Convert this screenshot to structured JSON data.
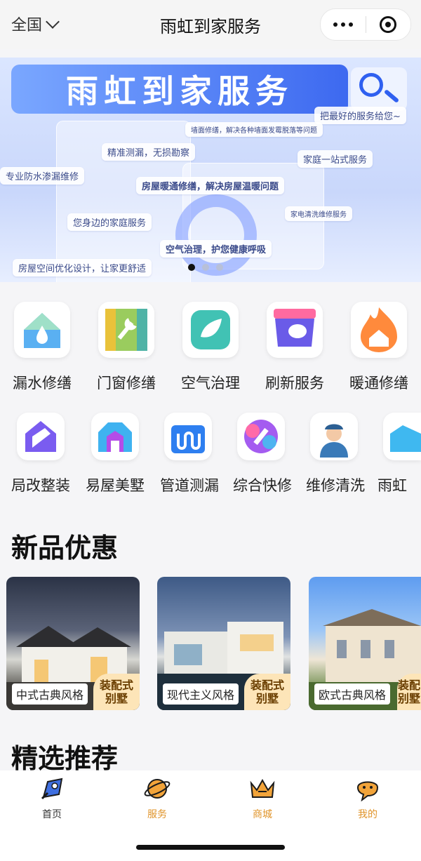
{
  "topbar": {
    "region": "全国",
    "title": "雨虹到家服务"
  },
  "banner": {
    "title": "雨虹到家服务",
    "bubbles": [
      "把最好的服务给您~",
      "墙面修缮，解决各种墙面发霉脱落等问题",
      "精准测漏，无损勘察",
      "家庭一站式服务",
      "专业防水渗漏维修",
      "房屋暖通修缮，解决房屋温暖问题",
      "家电清洗维修服务",
      "您身边的家庭服务",
      "空气治理，护您健康呼吸",
      "房屋空间优化设计，让家更舒适"
    ]
  },
  "services_row1": [
    {
      "label": "漏水修缮",
      "icon": "water-drop-house-icon"
    },
    {
      "label": "门窗修缮",
      "icon": "wrench-door-icon"
    },
    {
      "label": "空气治理",
      "icon": "leaf-icon"
    },
    {
      "label": "刷新服务",
      "icon": "paint-brush-icon"
    },
    {
      "label": "暖通修缮",
      "icon": "flame-house-icon"
    }
  ],
  "services_row2": [
    {
      "label": "局改整装",
      "icon": "house-shape-icon"
    },
    {
      "label": "易屋美墅",
      "icon": "villa-icon"
    },
    {
      "label": "管道测漏",
      "icon": "pipe-icon"
    },
    {
      "label": "综合快修",
      "icon": "hammer-icon"
    },
    {
      "label": "维修清洗",
      "icon": "worker-icon"
    },
    {
      "label": "雨虹",
      "icon": "partial-icon"
    }
  ],
  "new_products": {
    "title": "新品优惠",
    "cards": [
      {
        "name": "中式古典风格",
        "tag1": "装配式",
        "tag2": "别墅"
      },
      {
        "name": "现代主义风格",
        "tag1": "装配式",
        "tag2": "别墅"
      },
      {
        "name": "欧式古典风格",
        "tag1": "装配",
        "tag2": "别墅"
      }
    ]
  },
  "featured": {
    "title": "精选推荐"
  },
  "tabbar": [
    {
      "label": "首页",
      "icon": "rocket-icon",
      "color": "#333333"
    },
    {
      "label": "服务",
      "icon": "planet-icon",
      "color": "#e0942a"
    },
    {
      "label": "商城",
      "icon": "crown-icon",
      "color": "#e0942a"
    },
    {
      "label": "我的",
      "icon": "user-blob-icon",
      "color": "#e0942a"
    }
  ]
}
